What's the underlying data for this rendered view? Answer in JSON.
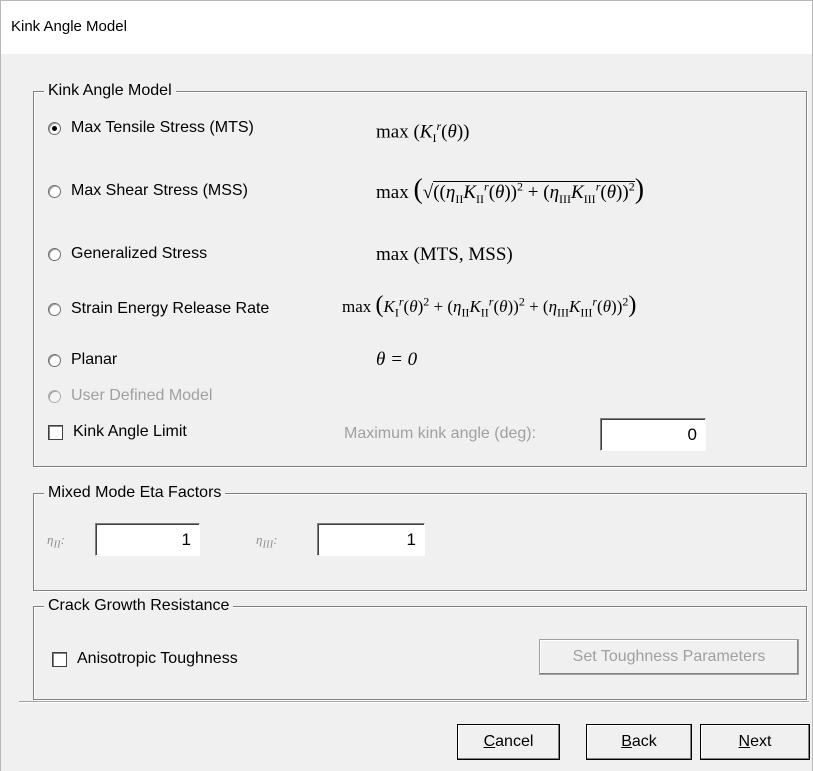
{
  "window": {
    "title": "Kink Angle Model"
  },
  "kink_group": {
    "legend": "Kink Angle Model",
    "options": [
      {
        "label": "Max Tensile Stress (MTS)",
        "checked": true
      },
      {
        "label": "Max Shear Stress (MSS)",
        "checked": false
      },
      {
        "label": "Generalized Stress",
        "checked": false
      },
      {
        "label": "Strain Energy Release Rate",
        "checked": false
      },
      {
        "label": "Planar",
        "checked": false
      },
      {
        "label": "User Defined Model",
        "checked": false,
        "disabled": true
      }
    ],
    "formulas": {
      "mts": "max",
      "mss": "max",
      "generalized": "max (MTS, MSS)",
      "serr": "max",
      "planar": "θ = 0"
    },
    "limit_checkbox_label": "Kink Angle Limit",
    "max_kink_label": "Maximum kink angle (deg):",
    "max_kink_value": "0"
  },
  "eta_group": {
    "legend": "Mixed Mode Eta Factors",
    "eta2_label": "η",
    "eta2_sub": "II",
    "eta2_value": "1",
    "eta3_label": "η",
    "eta3_sub": "III",
    "eta3_value": "1"
  },
  "crack_group": {
    "legend": "Crack Growth Resistance",
    "aniso_label": "Anisotropic Toughness",
    "set_params_label": "Set Toughness Parameters"
  },
  "buttons": {
    "cancel_first": "C",
    "cancel_rest": "ancel",
    "back_first": "B",
    "back_rest": "ack",
    "next_first": "N",
    "next_rest": "ext"
  }
}
